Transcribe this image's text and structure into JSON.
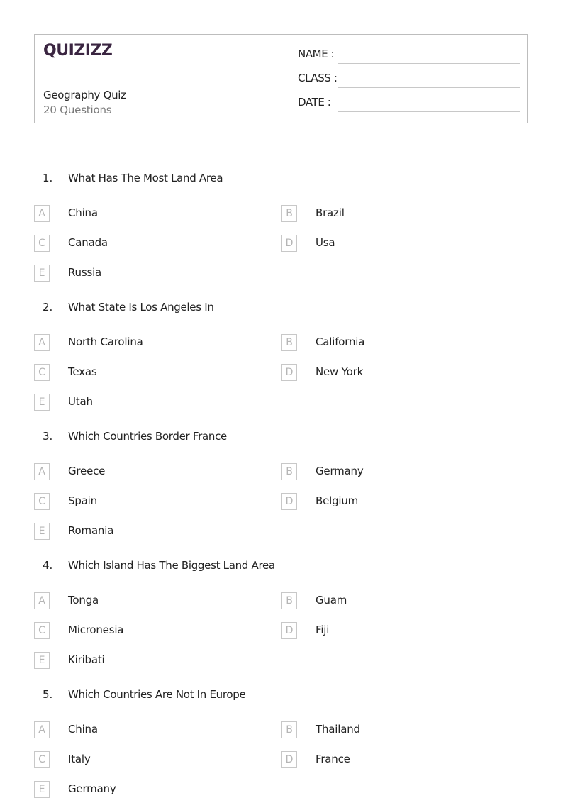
{
  "header": {
    "logo_text": "QUIZIZZ",
    "logo_color": "#3a2541",
    "title": "Geography Quiz",
    "question_count": "20 Questions",
    "fields": [
      {
        "label": "NAME :"
      },
      {
        "label": "CLASS :"
      },
      {
        "label": "DATE  :"
      }
    ]
  },
  "questions": [
    {
      "number": "1.",
      "text": "What Has The Most Land Area",
      "options": [
        {
          "letter": "A",
          "text": "China"
        },
        {
          "letter": "B",
          "text": "Brazil"
        },
        {
          "letter": "C",
          "text": "Canada"
        },
        {
          "letter": "D",
          "text": "Usa"
        },
        {
          "letter": "E",
          "text": "Russia"
        }
      ]
    },
    {
      "number": "2.",
      "text": "What State Is Los Angeles In",
      "options": [
        {
          "letter": "A",
          "text": "North Carolina"
        },
        {
          "letter": "B",
          "text": "California"
        },
        {
          "letter": "C",
          "text": "Texas"
        },
        {
          "letter": "D",
          "text": "New York"
        },
        {
          "letter": "E",
          "text": "Utah"
        }
      ]
    },
    {
      "number": "3.",
      "text": "Which Countries Border France",
      "options": [
        {
          "letter": "A",
          "text": "Greece"
        },
        {
          "letter": "B",
          "text": "Germany"
        },
        {
          "letter": "C",
          "text": "Spain"
        },
        {
          "letter": "D",
          "text": "Belgium"
        },
        {
          "letter": "E",
          "text": "Romania"
        }
      ]
    },
    {
      "number": "4.",
      "text": "Which Island Has The Biggest Land Area",
      "options": [
        {
          "letter": "A",
          "text": "Tonga"
        },
        {
          "letter": "B",
          "text": "Guam"
        },
        {
          "letter": "C",
          "text": "Micronesia"
        },
        {
          "letter": "D",
          "text": "Fiji"
        },
        {
          "letter": "E",
          "text": "Kiribati"
        }
      ]
    },
    {
      "number": "5.",
      "text": "Which Countries Are Not In Europe",
      "options": [
        {
          "letter": "A",
          "text": "China"
        },
        {
          "letter": "B",
          "text": "Thailand"
        },
        {
          "letter": "C",
          "text": "Italy"
        },
        {
          "letter": "D",
          "text": "France"
        },
        {
          "letter": "E",
          "text": "Germany"
        }
      ]
    }
  ]
}
